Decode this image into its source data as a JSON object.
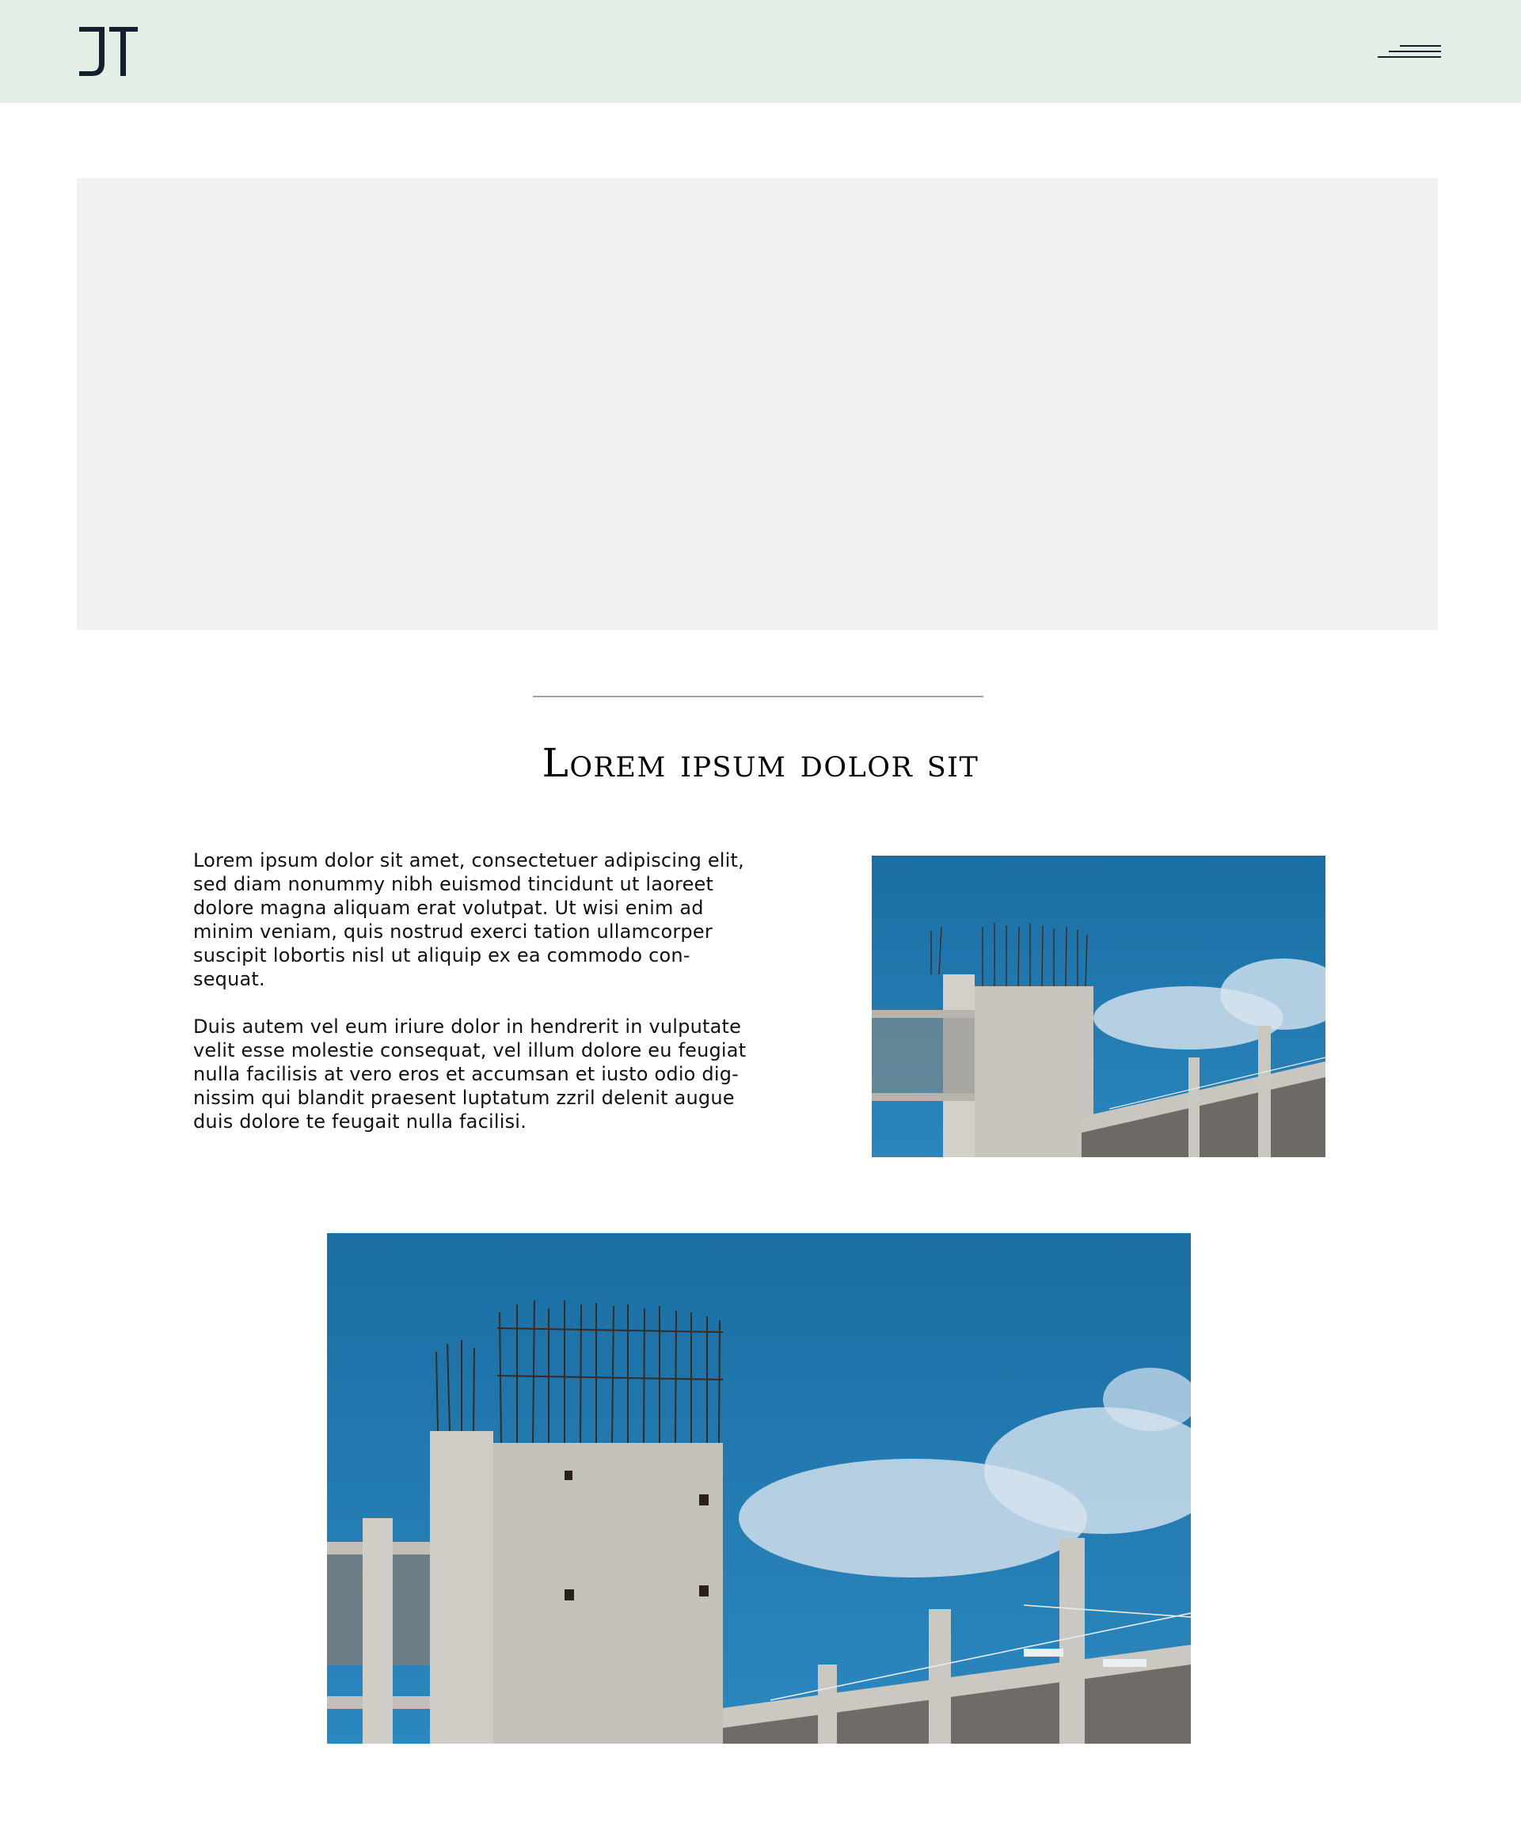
{
  "header": {
    "logo_text": "JT",
    "menu_icon": "hamburger-menu-icon",
    "background_color": "#e3efe6"
  },
  "hero": {
    "placeholder_color": "#f1f1f1"
  },
  "section": {
    "title": "Lorem ipsum dolor sit",
    "paragraphs": [
      "Lorem ipsum dolor sit amet, consectetuer adipiscing elit,\nsed diam nonummy nibh euismod tincidunt ut laoreet\ndolore magna aliquam erat volutpat. Ut wisi enim ad\nminim veniam, quis nostrud exerci tation ullamcorper\nsuscipit lobortis nisl ut aliquip ex ea commodo con-\nsequat.",
      "Duis autem vel eum iriure dolor in hendrerit in vulputate\nvelit esse molestie consequat, vel illum dolore eu feugiat\nnulla facilisis at vero eros et accumsan et iusto odio dig-\nnissim qui blandit praesent luptatum zzril delenit augue\nduis dolore te feugait nulla facilisi."
    ]
  },
  "images": {
    "small": "construction-building-photo",
    "large": "construction-building-photo"
  },
  "colors": {
    "sky": "#1f6f9f",
    "concrete": "#c9c6c0",
    "text": "#111111",
    "logo": "#14202e"
  }
}
